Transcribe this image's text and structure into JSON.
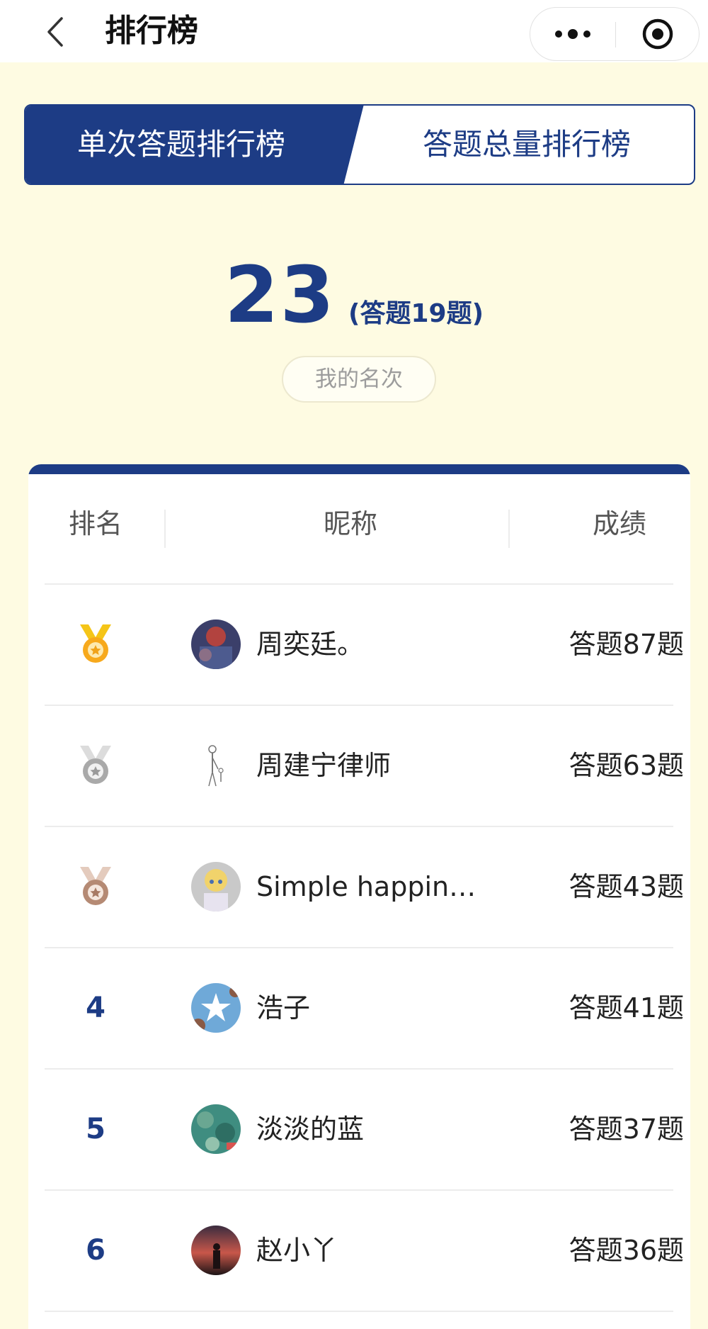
{
  "header": {
    "title": "排行榜",
    "icons": {
      "back": "back-chevron-icon",
      "more": "more-dots-icon",
      "close": "close-target-icon"
    }
  },
  "tabs": [
    {
      "label": "单次答题排行榜",
      "active": true
    },
    {
      "label": "答题总量排行榜",
      "active": false
    }
  ],
  "my_rank": {
    "position": "23",
    "detail": "(答题19题)",
    "label": "我的名次"
  },
  "table": {
    "columns": {
      "rank": "排名",
      "nickname": "昵称",
      "score": "成绩"
    },
    "rows": [
      {
        "rank": "1",
        "rank_icon": "gold-medal-icon",
        "avatar": "avatar-1-icon",
        "nickname": "周奕廷。",
        "score": "答题87题"
      },
      {
        "rank": "2",
        "rank_icon": "silver-medal-icon",
        "avatar": "avatar-2-icon",
        "nickname": "周建宁律师",
        "score": "答题63题"
      },
      {
        "rank": "3",
        "rank_icon": "bronze-medal-icon",
        "avatar": "avatar-3-icon",
        "nickname": "Simple happin…",
        "score": "答题43题"
      },
      {
        "rank": "4",
        "avatar": "avatar-4-icon",
        "nickname": "浩子",
        "score": "答题41题"
      },
      {
        "rank": "5",
        "avatar": "avatar-5-icon",
        "nickname": "淡淡的蓝",
        "score": "答题37题"
      },
      {
        "rank": "6",
        "avatar": "avatar-6-icon",
        "nickname": "赵小丫",
        "score": "答题36题"
      }
    ]
  },
  "colors": {
    "primary": "#1d3c85",
    "background": "#fefbe2",
    "gold": "#f0b020",
    "silver": "#a9a9a9",
    "bronze": "#b58a74"
  }
}
